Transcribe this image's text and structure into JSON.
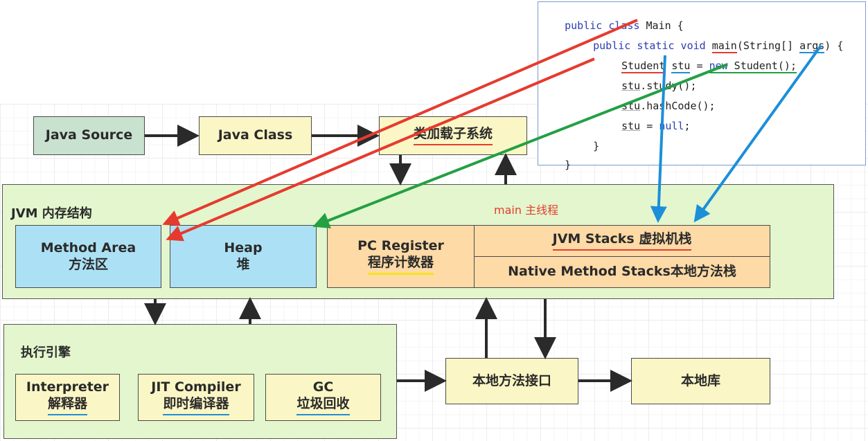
{
  "pipeline": {
    "java_source": "Java Source",
    "java_class": "Java Class",
    "class_loader": "类加载子系统"
  },
  "memory": {
    "title": "JVM 内存结构",
    "thread_label": "main 主线程",
    "method_area": {
      "en": "Method Area",
      "zh": "方法区"
    },
    "heap": {
      "en": "Heap",
      "zh": "堆"
    },
    "pc_register": {
      "en": "PC Register",
      "zh": "程序计数器"
    },
    "jvm_stacks": "JVM Stacks 虚拟机栈",
    "native_stacks": "Native Method Stacks本地方法栈"
  },
  "engine": {
    "title": "执行引擎",
    "interpreter": {
      "en": "Interpreter",
      "zh": "解释器"
    },
    "jit": {
      "en": "JIT Compiler",
      "zh": "即时编译器"
    },
    "gc": {
      "en": "GC",
      "zh": "垃圾回收"
    }
  },
  "native": {
    "interface": "本地方法接口",
    "library": "本地库"
  },
  "code": {
    "l1_kw": "public class ",
    "l1_rest": "Main {",
    "l2_kw": "public static void ",
    "l2_main": "main",
    "l2_mid": "(String[] ",
    "l2_args": "args",
    "l2_end": ") {",
    "l3_type": "Student",
    "l3_var": "stu",
    "l3_eq": " = ",
    "l3_new": "new",
    "l3_end": " Student();",
    "l4_var": "stu",
    "l4_rest": ".study();",
    "l5_var": "stu",
    "l5_rest": ".hashCode();",
    "l6_var": "stu",
    "l6_eq": " = ",
    "l6_null": "null",
    "l6_end": ";",
    "l7": "}",
    "l8": "}"
  },
  "colors": {
    "red_annotation": "#e53b2f",
    "green_annotation": "#23a043",
    "blue_annotation": "#1b8fd9",
    "keyword": "#2b3eb0"
  }
}
